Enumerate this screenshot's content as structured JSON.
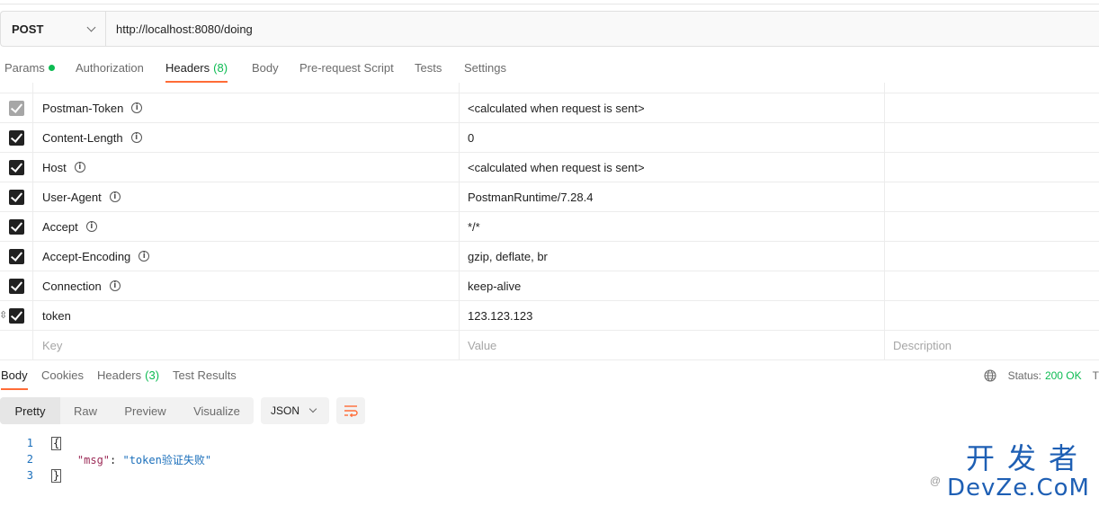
{
  "request": {
    "method": "POST",
    "url": "http://localhost:8080/doing"
  },
  "request_tabs": [
    {
      "label": "Params",
      "count": "",
      "active": false,
      "has_dot": true
    },
    {
      "label": "Authorization",
      "count": "",
      "active": false,
      "has_dot": false
    },
    {
      "label": "Headers",
      "count": "(8)",
      "active": true,
      "has_dot": false
    },
    {
      "label": "Body",
      "count": "",
      "active": false,
      "has_dot": false
    },
    {
      "label": "Pre-request Script",
      "count": "",
      "active": false,
      "has_dot": false
    },
    {
      "label": "Tests",
      "count": "",
      "active": false,
      "has_dot": false
    },
    {
      "label": "Settings",
      "count": "",
      "active": false,
      "has_dot": false
    }
  ],
  "headers": {
    "rows": [
      {
        "key": "Postman-Token",
        "value": "<calculated when request is sent>",
        "checked": true,
        "disabled": true,
        "info": true
      },
      {
        "key": "Content-Length",
        "value": "0",
        "checked": true,
        "disabled": false,
        "info": true
      },
      {
        "key": "Host",
        "value": "<calculated when request is sent>",
        "checked": true,
        "disabled": false,
        "info": true
      },
      {
        "key": "User-Agent",
        "value": "PostmanRuntime/7.28.4",
        "checked": true,
        "disabled": false,
        "info": true
      },
      {
        "key": "Accept",
        "value": "*/*",
        "checked": true,
        "disabled": false,
        "info": true
      },
      {
        "key": "Accept-Encoding",
        "value": "gzip, deflate, br",
        "checked": true,
        "disabled": false,
        "info": true
      },
      {
        "key": "Connection",
        "value": "keep-alive",
        "checked": true,
        "disabled": false,
        "info": true
      },
      {
        "key": "token",
        "value": "123.123.123",
        "checked": true,
        "disabled": false,
        "info": false
      }
    ],
    "new_row": {
      "key_placeholder": "Key",
      "value_placeholder": "Value",
      "description_placeholder": "Description"
    }
  },
  "response_tabs": [
    {
      "label": "Body",
      "count": "",
      "active": true
    },
    {
      "label": "Cookies",
      "count": "",
      "active": false
    },
    {
      "label": "Headers",
      "count": "(3)",
      "active": false
    },
    {
      "label": "Test Results",
      "count": "",
      "active": false
    }
  ],
  "status": {
    "label": "Status:",
    "value": "200 OK",
    "trailing": "T"
  },
  "view_tabs": [
    {
      "label": "Pretty",
      "active": true
    },
    {
      "label": "Raw",
      "active": false
    },
    {
      "label": "Preview",
      "active": false
    },
    {
      "label": "Visualize",
      "active": false
    }
  ],
  "format": "JSON",
  "code_lines": [
    {
      "n": "1",
      "parts": [
        {
          "t": "{",
          "c": "brace"
        }
      ]
    },
    {
      "n": "2",
      "parts": [
        {
          "t": "    ",
          "c": "json-punct"
        },
        {
          "t": "\"msg\"",
          "c": "json-key"
        },
        {
          "t": ": ",
          "c": "json-punct"
        },
        {
          "t": "\"token验证失败\"",
          "c": "json-str"
        }
      ]
    },
    {
      "n": "3",
      "parts": [
        {
          "t": "}",
          "c": "brace"
        }
      ]
    }
  ],
  "watermark": {
    "top": "开发者",
    "bottom": "DevZe.CoM",
    "small": "@"
  },
  "colors": {
    "accent": "#ff6c37",
    "success": "#0cbb52",
    "link": "#1b6fbb"
  }
}
